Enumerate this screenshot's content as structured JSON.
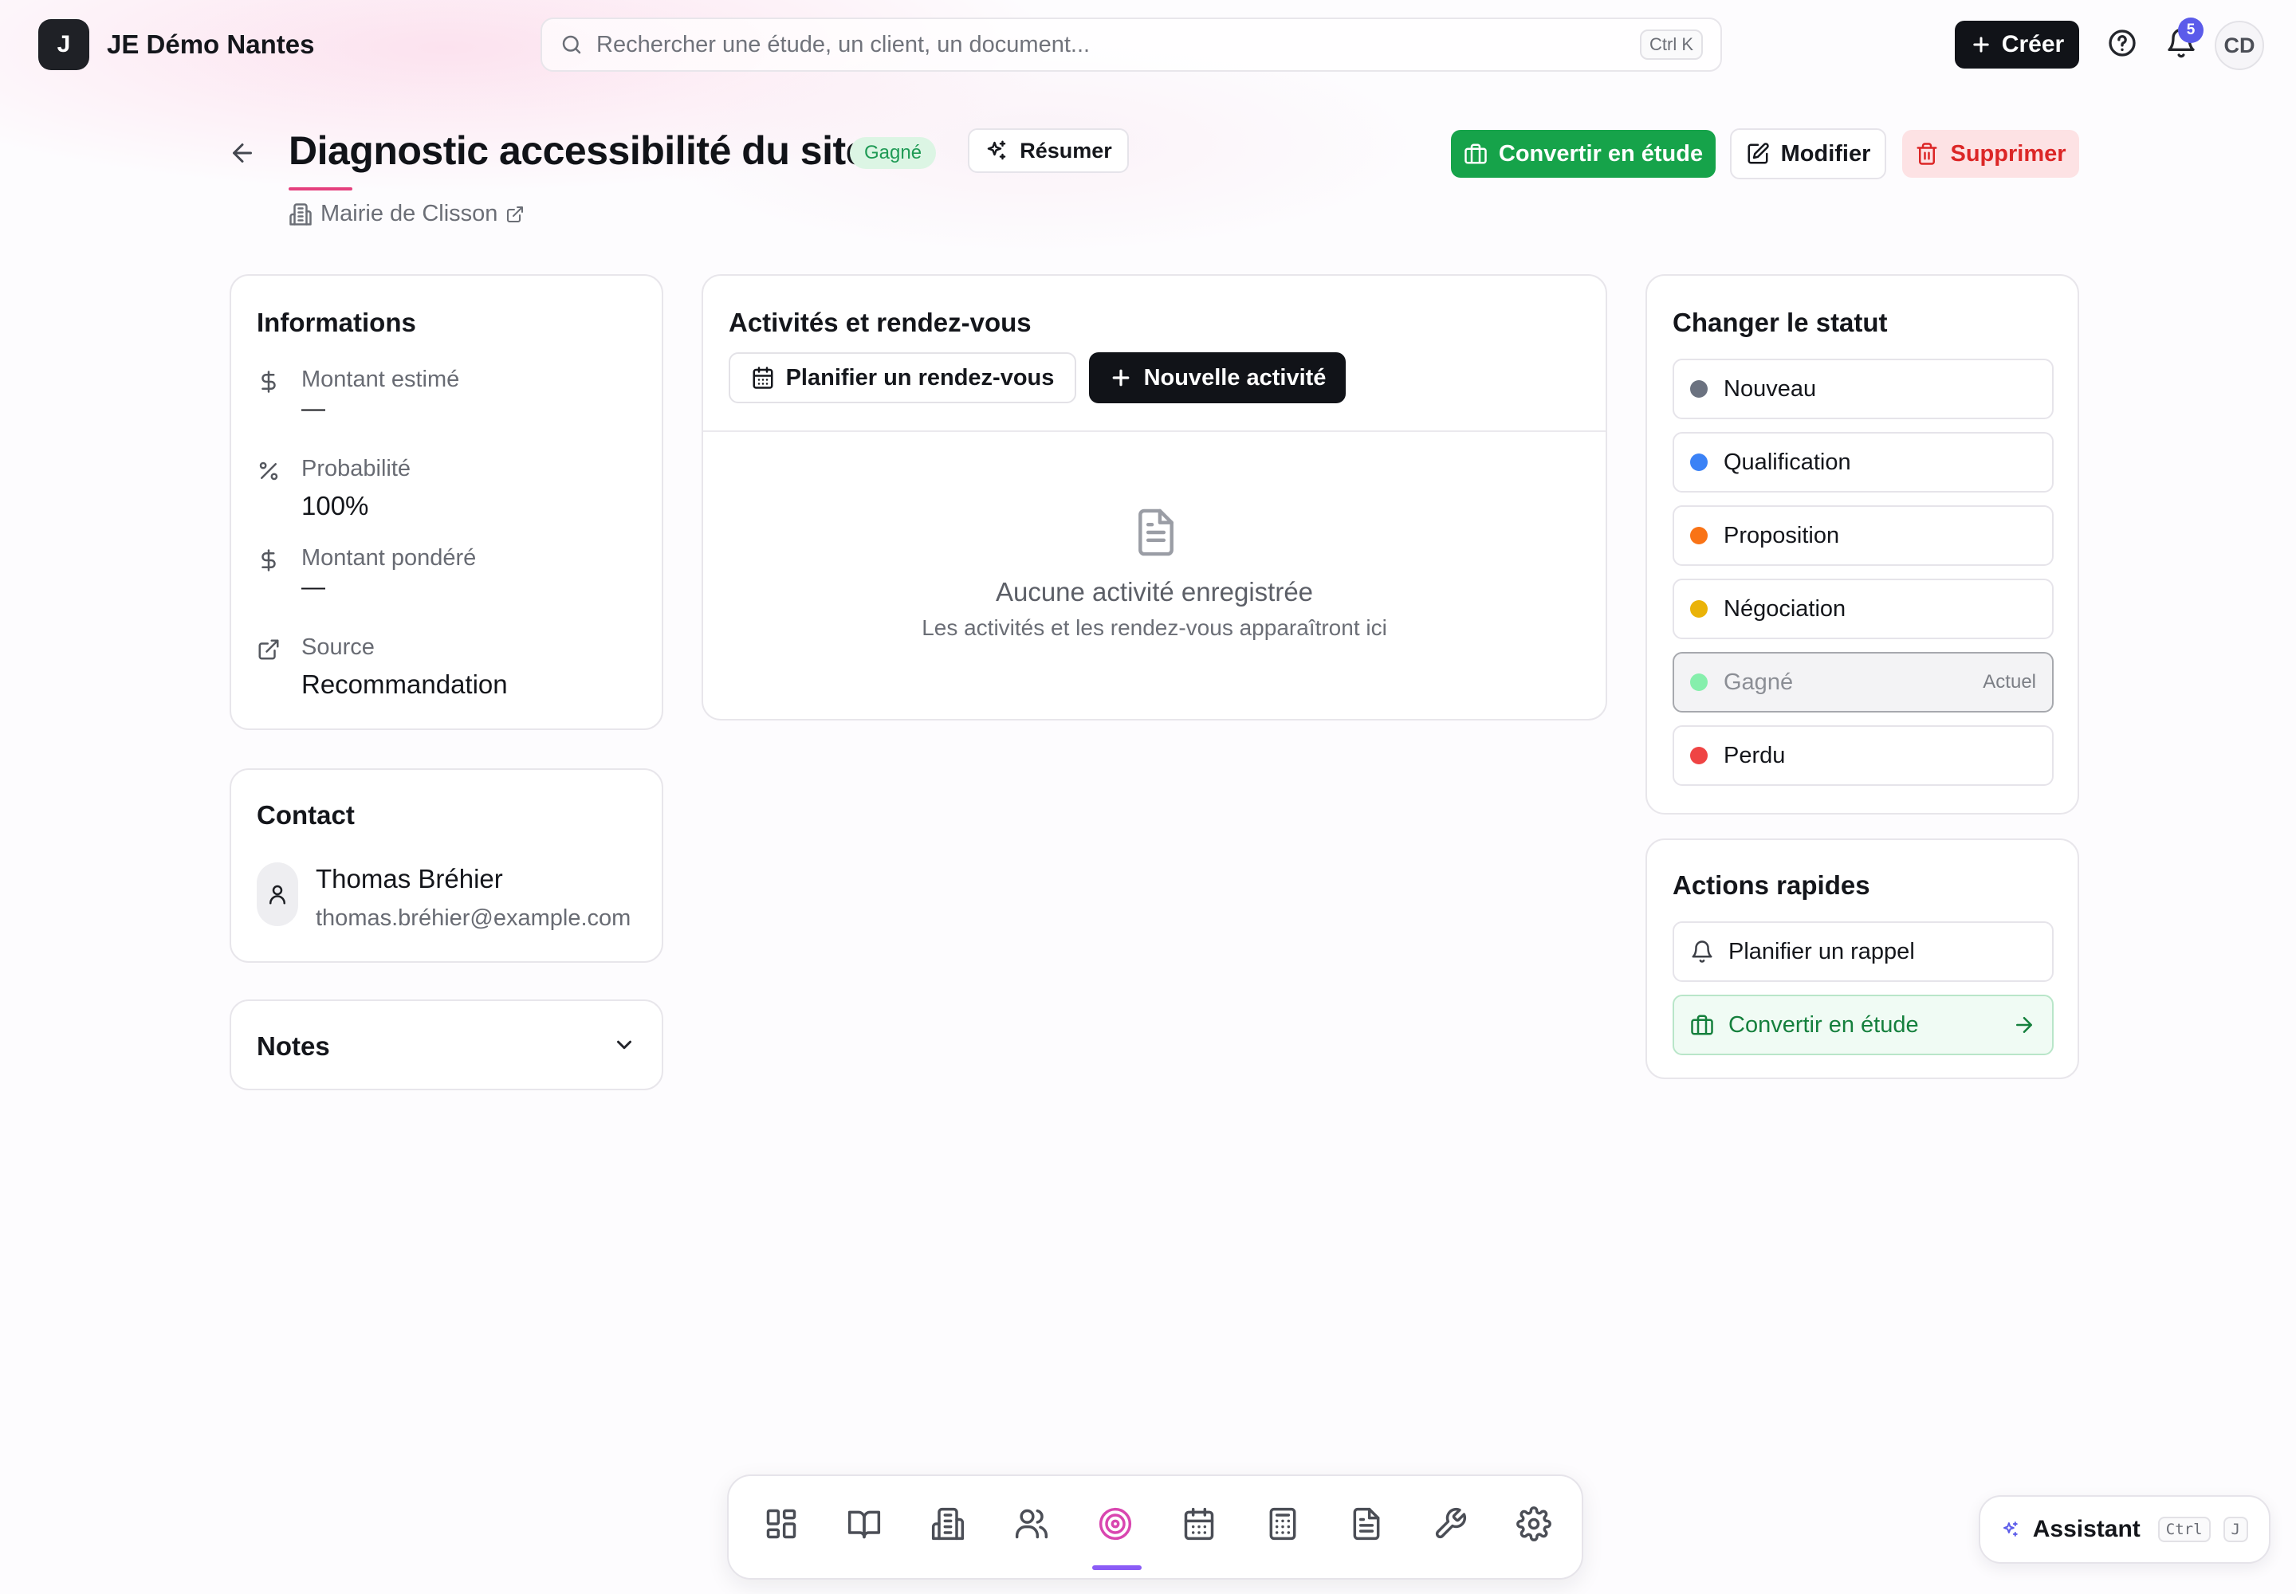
{
  "app": {
    "logo_letter": "J",
    "name": "JE Démo Nantes"
  },
  "search": {
    "placeholder": "Rechercher une étude, un client, un document...",
    "shortcut": "Ctrl K"
  },
  "topbar": {
    "create_label": "Créer",
    "notifications_count": "5",
    "user_initials": "CD"
  },
  "header": {
    "title": "Diagnostic accessibilité du site",
    "status": "Gagné",
    "summarize_label": "Résumer",
    "client": "Mairie de Clisson",
    "convert_label": "Convertir en étude",
    "edit_label": "Modifier",
    "delete_label": "Supprimer"
  },
  "informations": {
    "title": "Informations",
    "rows": [
      {
        "icon": "dollar-icon",
        "label": "Montant estimé",
        "value": "—"
      },
      {
        "icon": "percent-icon",
        "label": "Probabilité",
        "value": "100%"
      },
      {
        "icon": "dollar-icon",
        "label": "Montant pondéré",
        "value": "—"
      },
      {
        "icon": "external-link-icon",
        "label": "Source",
        "value": "Recommandation"
      }
    ]
  },
  "contact": {
    "title": "Contact",
    "name": "Thomas Bréhier",
    "email": "thomas.bréhier@example.com"
  },
  "notes": {
    "title": "Notes"
  },
  "activities": {
    "title": "Activités et rendez-vous",
    "plan_label": "Planifier un rendez-vous",
    "new_label": "Nouvelle activité",
    "empty_title": "Aucune activité enregistrée",
    "empty_subtitle": "Les activités et les rendez-vous apparaîtront ici"
  },
  "status_panel": {
    "title": "Changer le statut",
    "current_label": "Actuel",
    "options": [
      {
        "label": "Nouveau",
        "color": "#6b7280"
      },
      {
        "label": "Qualification",
        "color": "#3b82f6"
      },
      {
        "label": "Proposition",
        "color": "#f97316"
      },
      {
        "label": "Négociation",
        "color": "#eab308"
      },
      {
        "label": "Gagné",
        "color": "#86efac",
        "current": true
      },
      {
        "label": "Perdu",
        "color": "#ef4444"
      }
    ]
  },
  "quick_actions": {
    "title": "Actions rapides",
    "reminder_label": "Planifier un rappel",
    "convert_label": "Convertir en étude"
  },
  "dock": {
    "items": [
      "dashboard-icon",
      "book-icon",
      "building-icon",
      "users-icon",
      "target-icon",
      "calendar-icon",
      "calculator-icon",
      "document-icon",
      "wrench-icon",
      "settings-icon"
    ],
    "active_item": "target-icon"
  },
  "assistant": {
    "label": "Assistant",
    "shortcut_modifier": "Ctrl",
    "shortcut_key": "J"
  },
  "colors": {
    "accent_green": "#16a34a",
    "danger": "#dc2626",
    "brand_dark": "#111318",
    "active_nav": "#d946b0"
  }
}
